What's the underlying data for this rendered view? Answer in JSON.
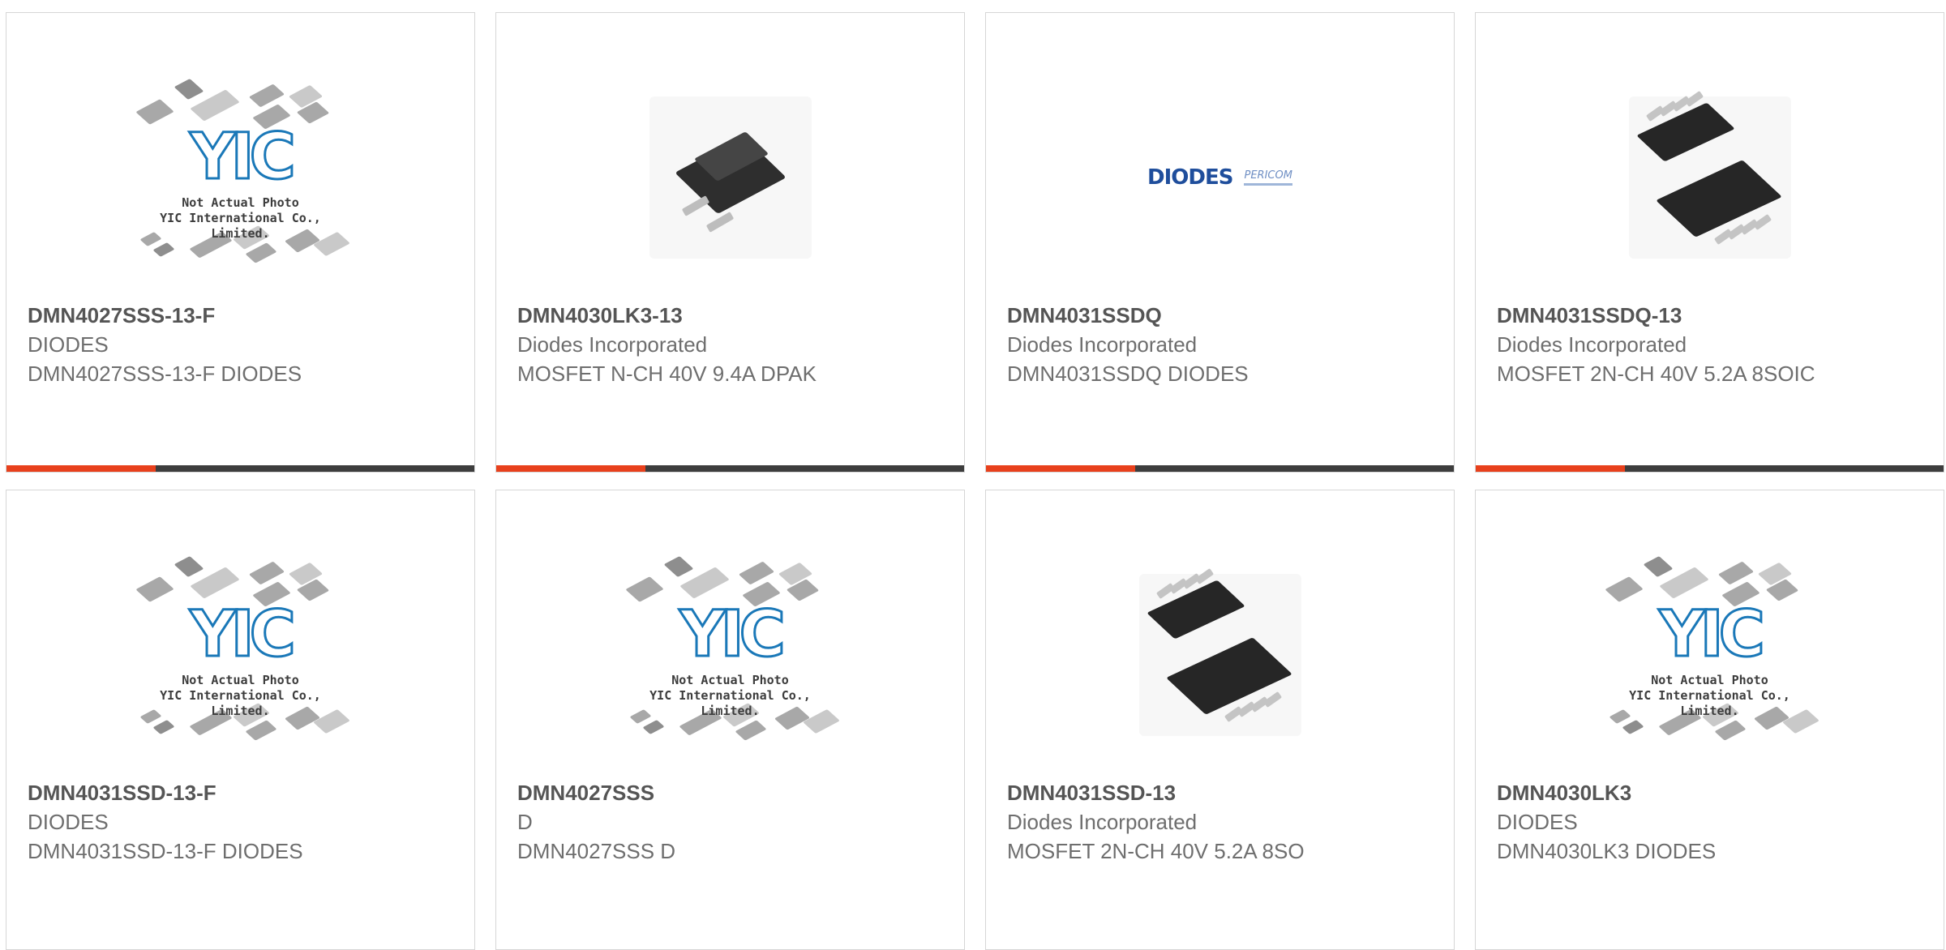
{
  "products": [
    {
      "part": "DMN4027SSS-13-F",
      "manufacturer": "DIODES",
      "description": "DMN4027SSS-13-F DIODES",
      "image": "placeholder",
      "image_caption_1": "Not Actual Photo",
      "image_caption_2": "YIC International Co., Limited.",
      "image_logo": "YIC"
    },
    {
      "part": "DMN4030LK3-13",
      "manufacturer": "Diodes Incorporated",
      "description": "MOSFET N-CH 40V 9.4A DPAK",
      "image": "dpak-package"
    },
    {
      "part": "DMN4031SSDQ",
      "manufacturer": "Diodes Incorporated",
      "description": "DMN4031SSDQ DIODES",
      "image": "diodes-logo",
      "image_logo": "DIODES",
      "image_logo_2": "PERICOM"
    },
    {
      "part": "DMN4031SSDQ-13",
      "manufacturer": "Diodes Incorporated",
      "description": "MOSFET 2N-CH 40V 5.2A 8SOIC",
      "image": "soic-package"
    },
    {
      "part": "DMN4031SSD-13-F",
      "manufacturer": "DIODES",
      "description": "DMN4031SSD-13-F DIODES",
      "image": "placeholder",
      "image_caption_1": "Not Actual Photo",
      "image_caption_2": "YIC International Co., Limited.",
      "image_logo": "YIC"
    },
    {
      "part": "DMN4027SSS",
      "manufacturer": "D",
      "description": "DMN4027SSS D",
      "image": "placeholder",
      "image_caption_1": "Not Actual Photo",
      "image_caption_2": "YIC International Co., Limited.",
      "image_logo": "YIC"
    },
    {
      "part": "DMN4031SSD-13",
      "manufacturer": "Diodes Incorporated",
      "description": "MOSFET 2N-CH 40V 5.2A 8SO",
      "image": "soic-package"
    },
    {
      "part": "DMN4030LK3",
      "manufacturer": "DIODES",
      "description": "DMN4030LK3 DIODES",
      "image": "placeholder",
      "image_caption_1": "Not Actual Photo",
      "image_caption_2": "YIC International Co., Limited.",
      "image_logo": "YIC"
    }
  ],
  "colors": {
    "accent": "#e8401c",
    "bar": "#3d3d3d",
    "part_text": "#555555",
    "body_text": "#6e6e6e",
    "logo_blue": "#1a78b8"
  }
}
